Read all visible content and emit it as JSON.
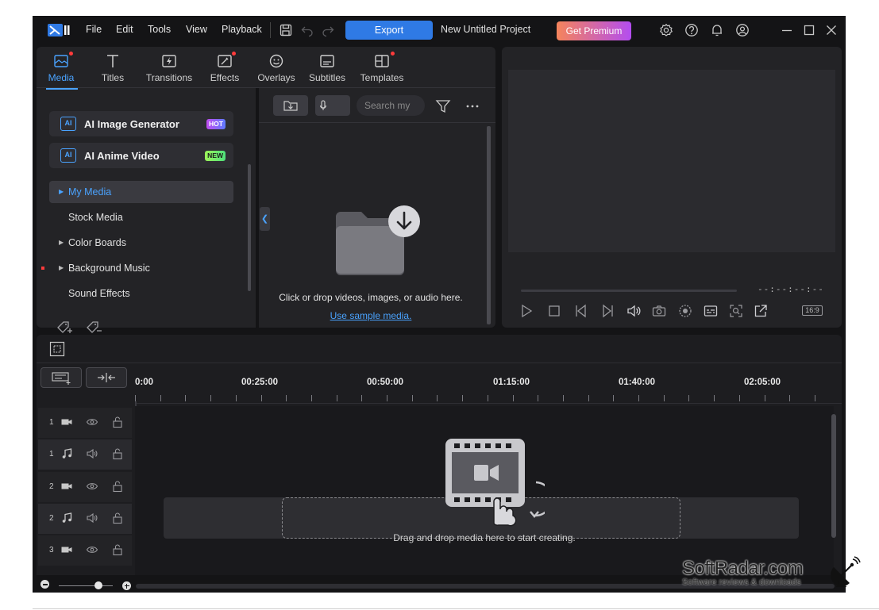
{
  "menu": {
    "file": "File",
    "edit": "Edit",
    "tools": "Tools",
    "view": "View",
    "playback": "Playback"
  },
  "toolbar": {
    "export_label": "Export",
    "project_title": "New Untitled Project",
    "premium_label": "Get Premium"
  },
  "tabs": [
    {
      "label": "Media",
      "icon": "media-icon",
      "active": true,
      "dot": true
    },
    {
      "label": "Titles",
      "icon": "titles-icon",
      "active": false,
      "dot": false
    },
    {
      "label": "Transitions",
      "icon": "transitions-icon",
      "active": false,
      "dot": false
    },
    {
      "label": "Effects",
      "icon": "effects-icon",
      "active": false,
      "dot": true
    },
    {
      "label": "Overlays",
      "icon": "overlays-icon",
      "active": false,
      "dot": false
    },
    {
      "label": "Subtitles",
      "icon": "subtitles-icon",
      "active": false,
      "dot": false
    },
    {
      "label": "Templates",
      "icon": "templates-icon",
      "active": false,
      "dot": true
    }
  ],
  "ai": {
    "image_generator": {
      "label": "AI Image Generator",
      "badge": "HOT",
      "icon_text": "AI"
    },
    "anime_video": {
      "label": "AI Anime Video",
      "badge": "NEW",
      "icon_text": "AI"
    }
  },
  "nav": [
    {
      "label": "My Media",
      "active": true,
      "expandable": true
    },
    {
      "label": "Stock Media",
      "active": false,
      "expandable": false
    },
    {
      "label": "Color Boards",
      "active": false,
      "expandable": true
    },
    {
      "label": "Background Music",
      "active": false,
      "expandable": true
    },
    {
      "label": "Sound Effects",
      "active": false,
      "expandable": false
    }
  ],
  "library": {
    "search_placeholder": "Search my",
    "drop_text": "Click or drop videos, images, or audio here.",
    "sample_link": "Use sample media."
  },
  "preview": {
    "timecode": "--:--:--:--",
    "aspect": "16:9"
  },
  "timeline": {
    "ticks": [
      "0:00",
      "00:25:00",
      "00:50:00",
      "01:15:00",
      "01:40:00",
      "02:05:00"
    ],
    "drop_text": "Drag and drop media here to start creating.",
    "tracks": [
      {
        "num": "1",
        "type": "video"
      },
      {
        "num": "1",
        "type": "audio"
      },
      {
        "num": "2",
        "type": "video"
      },
      {
        "num": "2",
        "type": "audio"
      },
      {
        "num": "3",
        "type": "video"
      }
    ]
  },
  "watermark": {
    "title": "SoftRadar.com",
    "subtitle": "Software reviews & downloads"
  },
  "colors": {
    "accent": "#4aa3ff",
    "export": "#2f7ae5",
    "background": "#141416",
    "panel": "#232326"
  }
}
